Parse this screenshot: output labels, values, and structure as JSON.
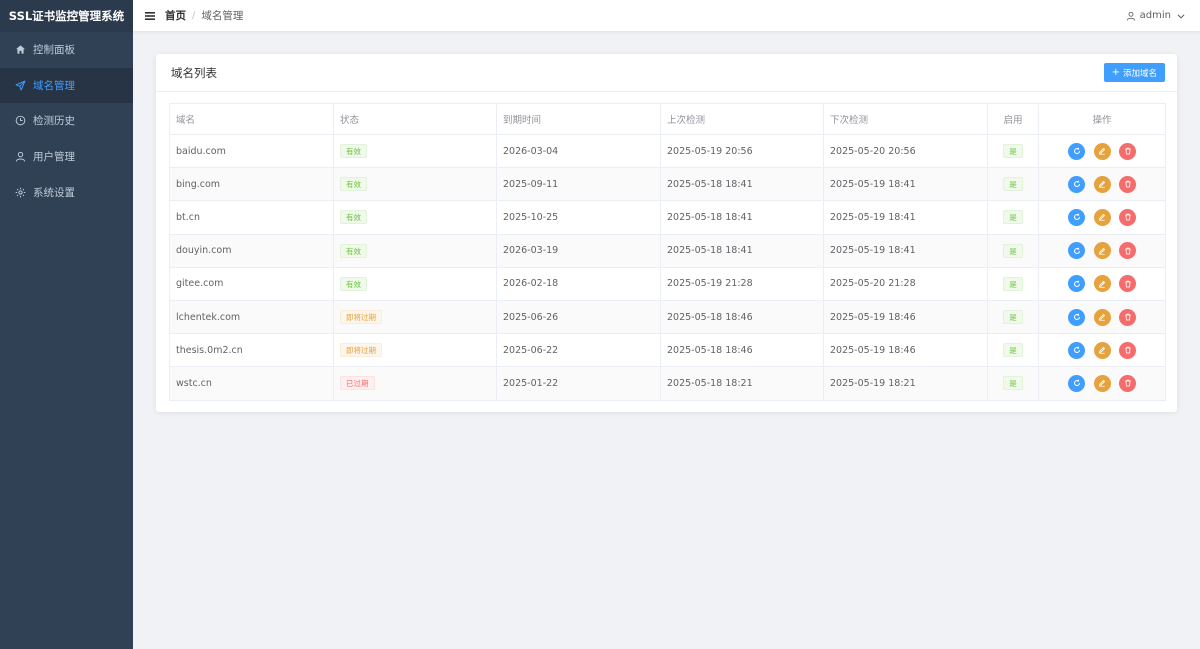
{
  "app": {
    "title": "SSL证书监控管理系统"
  },
  "sidebar": {
    "items": [
      {
        "label": "控制面板",
        "icon": "home-icon",
        "active": false
      },
      {
        "label": "域名管理",
        "icon": "send-icon",
        "active": true
      },
      {
        "label": "检测历史",
        "icon": "clock-icon",
        "active": false
      },
      {
        "label": "用户管理",
        "icon": "user-icon",
        "active": false
      },
      {
        "label": "系统设置",
        "icon": "gear-icon",
        "active": false
      }
    ]
  },
  "header": {
    "breadcrumb": {
      "home": "首页",
      "separator": "/",
      "current": "域名管理"
    },
    "user": "admin"
  },
  "card": {
    "title": "域名列表",
    "add_button": "添加域名"
  },
  "table": {
    "columns": [
      "域名",
      "状态",
      "到期时间",
      "上次检测",
      "下次检测",
      "启用",
      "操作"
    ],
    "rows": [
      {
        "domain": "baidu.com",
        "status": "有效",
        "status_type": "success",
        "expire": "2026-03-04",
        "last_check": "2025-05-19 20:56",
        "next_check": "2025-05-20 20:56",
        "enabled": "是"
      },
      {
        "domain": "bing.com",
        "status": "有效",
        "status_type": "success",
        "expire": "2025-09-11",
        "last_check": "2025-05-18 18:41",
        "next_check": "2025-05-19 18:41",
        "enabled": "是"
      },
      {
        "domain": "bt.cn",
        "status": "有效",
        "status_type": "success",
        "expire": "2025-10-25",
        "last_check": "2025-05-18 18:41",
        "next_check": "2025-05-19 18:41",
        "enabled": "是"
      },
      {
        "domain": "douyin.com",
        "status": "有效",
        "status_type": "success",
        "expire": "2026-03-19",
        "last_check": "2025-05-18 18:41",
        "next_check": "2025-05-19 18:41",
        "enabled": "是"
      },
      {
        "domain": "gitee.com",
        "status": "有效",
        "status_type": "success",
        "expire": "2026-02-18",
        "last_check": "2025-05-19 21:28",
        "next_check": "2025-05-20 21:28",
        "enabled": "是"
      },
      {
        "domain": "lchentek.com",
        "status": "即将过期",
        "status_type": "warning",
        "expire": "2025-06-26",
        "last_check": "2025-05-18 18:46",
        "next_check": "2025-05-19 18:46",
        "enabled": "是"
      },
      {
        "domain": "thesis.0m2.cn",
        "status": "即将过期",
        "status_type": "warning",
        "expire": "2025-06-22",
        "last_check": "2025-05-18 18:46",
        "next_check": "2025-05-19 18:46",
        "enabled": "是"
      },
      {
        "domain": "wstc.cn",
        "status": "已过期",
        "status_type": "danger",
        "expire": "2025-01-22",
        "last_check": "2025-05-18 18:21",
        "next_check": "2025-05-19 18:21",
        "enabled": "是"
      }
    ]
  },
  "colors": {
    "sidebar_bg": "#304156",
    "accent": "#409eff",
    "success": "#67c23a",
    "warning": "#e6a23c",
    "danger": "#f56c6c"
  }
}
